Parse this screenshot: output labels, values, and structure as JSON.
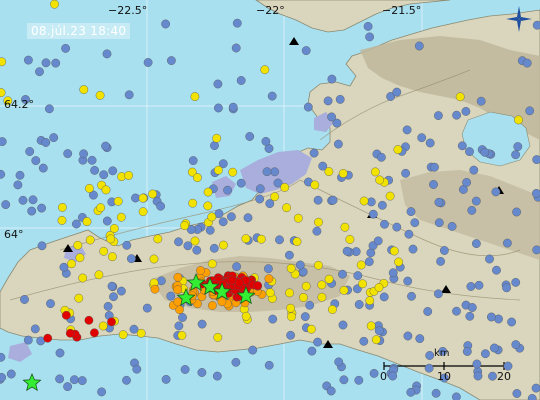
{
  "map": {
    "timestamp": "08.júl.23  18:40",
    "lon_labels": [
      "−22.5°",
      "−22°",
      "−21.5°"
    ],
    "lat_labels": [
      "64.2°",
      "64°"
    ],
    "scale": {
      "unit": "km",
      "ticks": [
        "0",
        "10",
        "20"
      ]
    },
    "colors": {
      "sea": "#a8e0f0",
      "land": "#d9d6bd",
      "highland": "#bfb79c",
      "lake": "#a9aedc",
      "recent_quake": "#e00000",
      "hours_quake": "#ff9f00",
      "day_quake": "#f2e200",
      "older_quake": "#6688cc",
      "large_quake": "#33ee33"
    },
    "logo_icon": "imo-logo-icon"
  }
}
